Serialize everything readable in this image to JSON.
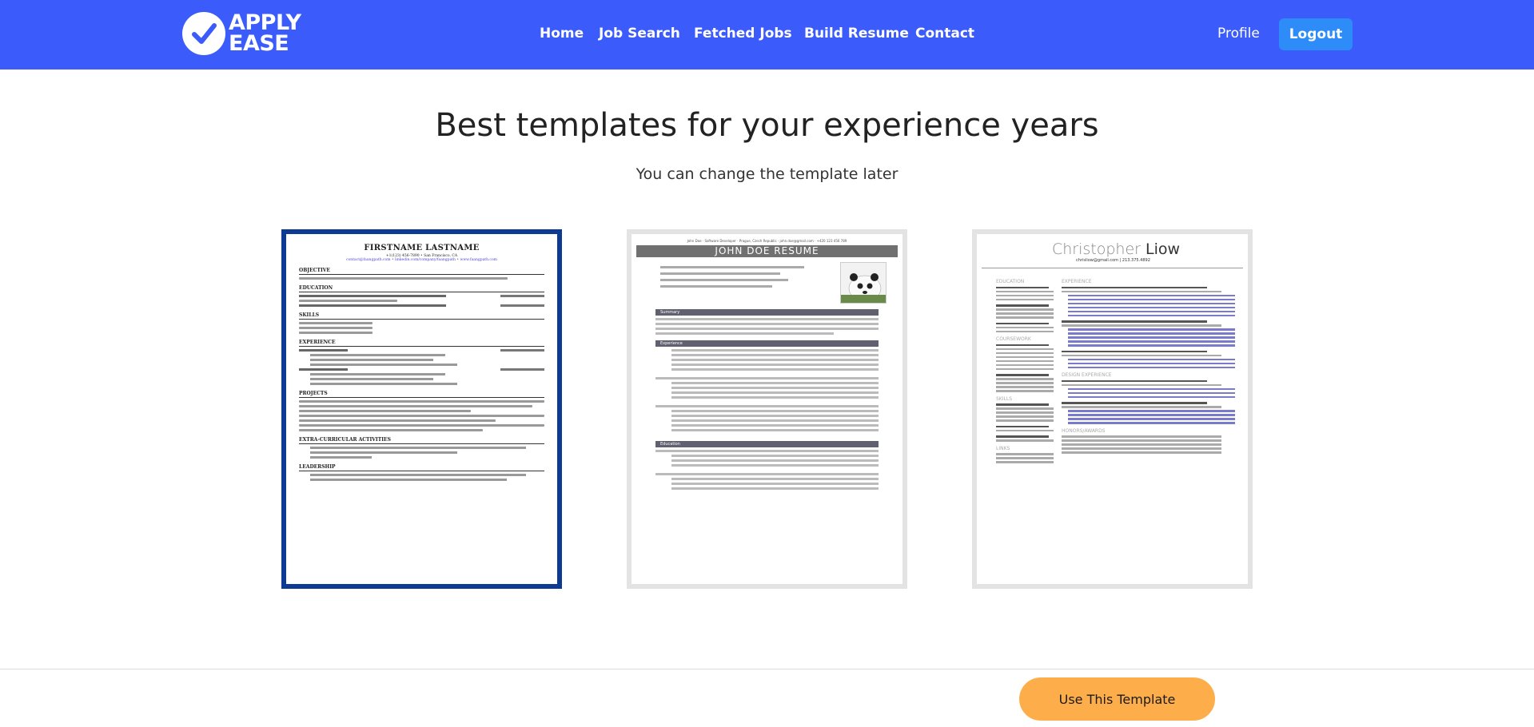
{
  "navbar": {
    "logo_line1": "APPLY",
    "logo_line2": "EASE",
    "links": [
      "Home",
      "Job Search",
      "Fetched Jobs",
      "Build Resume",
      "Contact"
    ],
    "profile": "Profile",
    "logout": "Logout",
    "color": "#3b5bfb"
  },
  "main": {
    "title": "Best templates for your experience years",
    "subtitle": "You can change the template later"
  },
  "templates": [
    {
      "name_text": "FIRSTNAME LASTNAME",
      "contact": "+1(123) 456-7890 • San Francisco, CA",
      "links": "contact@faangpath.com • linkedin.com/company/faangpath • www.faangpath.com",
      "sections": [
        "OBJECTIVE",
        "EDUCATION",
        "SKILLS",
        "EXPERIENCE",
        "PROJECTS",
        "EXTRA-CURRICULAR ACTIVITIES",
        "LEADERSHIP"
      ],
      "selected": true
    },
    {
      "top": "John Doe · Software Developer · Prague, Czech Republic · john.doe@gmail.com · +420 123 456 789",
      "banner": "JOHN DOE RESUME",
      "sections": [
        "Summary",
        "Experience",
        "Education"
      ]
    },
    {
      "first": "Christopher",
      "last": "Liow",
      "email": "chrisliow@gmail.com | 213.375.4892",
      "left_sections": [
        "EDUCATION",
        "COURSEWORK",
        "SKILLS",
        "LINKS"
      ],
      "right_sections": [
        "EXPERIENCE",
        "DESIGN EXPERIENCE",
        "HONORS/AWARDS"
      ]
    }
  ],
  "footer": {
    "button": "Use This Template",
    "button_color": "#fdae4b"
  }
}
